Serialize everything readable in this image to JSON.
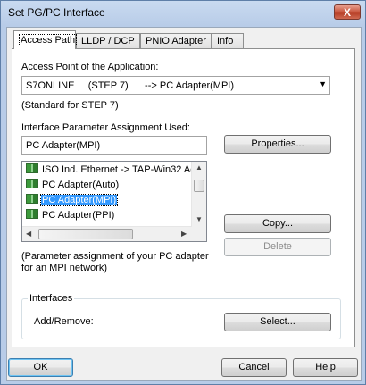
{
  "window": {
    "title": "Set PG/PC Interface",
    "close_label": "X"
  },
  "tabs": [
    {
      "label": "Access Path"
    },
    {
      "label": "LLDP / DCP"
    },
    {
      "label": "PNIO Adapter"
    },
    {
      "label": "Info"
    }
  ],
  "access_point": {
    "label": "Access Point of the Application:",
    "value": "S7ONLINE     (STEP 7)      --> PC Adapter(MPI)",
    "note": "(Standard for STEP 7)"
  },
  "interface_param": {
    "label": "Interface Parameter Assignment Used:",
    "value": "PC Adapter(MPI)",
    "items": [
      {
        "label": "ISO Ind. Ethernet -> TAP-Win32 Ad"
      },
      {
        "label": "PC Adapter(Auto)"
      },
      {
        "label": "PC Adapter(MPI)"
      },
      {
        "label": "PC Adapter(PPI)"
      }
    ],
    "description": "(Parameter assignment of your PC adapter\nfor an MPI network)"
  },
  "buttons": {
    "properties": "Properties...",
    "copy": "Copy...",
    "delete": "Delete",
    "select": "Select...",
    "ok": "OK",
    "cancel": "Cancel",
    "help": "Help"
  },
  "interfaces": {
    "title": "Interfaces",
    "add_remove_label": "Add/Remove:"
  }
}
